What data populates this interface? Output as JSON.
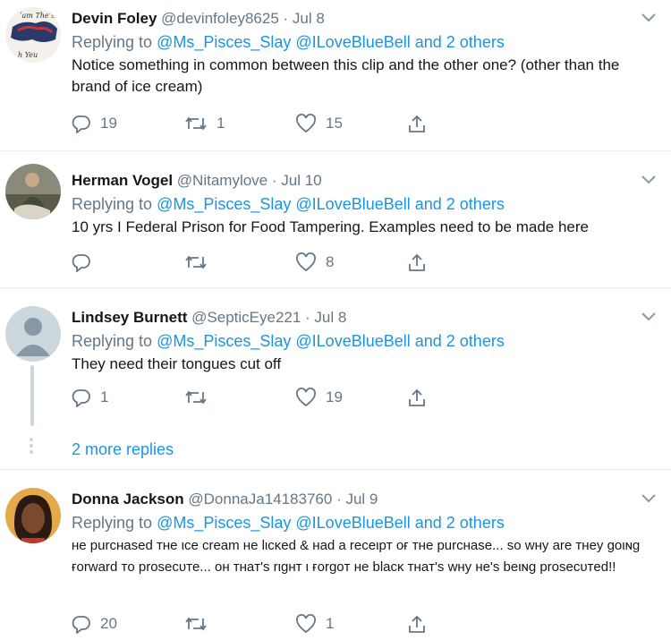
{
  "tweets": [
    {
      "name": "Devin Foley",
      "handle": "@devinfoley8625",
      "date": "· Jul 8",
      "replying_prefix": "Replying to",
      "replying_to": "@Ms_Pisces_Slay @ILoveBlueBell and 2 others",
      "text": "Notice something in common between this clip and the other one? (other than the brand of ice cream)",
      "replies": "19",
      "retweets": "1",
      "likes": "15"
    },
    {
      "name": "Herman Vogel",
      "handle": "@Nitamylove",
      "date": "· Jul 10",
      "replying_prefix": "Replying to",
      "replying_to": "@Ms_Pisces_Slay @ILoveBlueBell and 2 others",
      "text": "10 yrs I Federal Prison for Food Tampering. Examples need to be made here",
      "replies": "",
      "retweets": "",
      "likes": "8"
    },
    {
      "name": "Lindsey Burnett",
      "handle": "@SepticEye221",
      "date": "· Jul 8",
      "replying_prefix": "Replying to",
      "replying_to": "@Ms_Pisces_Slay @ILoveBlueBell and 2 others",
      "text": "They need their tongues cut off",
      "replies": "1",
      "retweets": "",
      "likes": "19"
    },
    {
      "name": "Donna Jackson",
      "handle": "@DonnaJa14183760",
      "date": "· Jul 9",
      "replying_prefix": "Replying to",
      "replying_to": "@Ms_Pisces_Slay @ILoveBlueBell and 2 others",
      "text": "ʜe purcʜased тʜe ιce cream ʜe lιcĸed & ʜad a receιpт oғ тʜe purcʜase... so wʜy are тʜey goιɴg ғorward тo proѕecυтe... oʜ тʜaт'ѕ rιgʜт ι ғorgoт ʜe blacĸ тʜaт'ѕ wʜy ʜe'ѕ beιɴg proѕecυтed!!",
      "replies": "20",
      "retweets": "",
      "likes": "1"
    }
  ],
  "more_replies": "2 more replies",
  "colors": {
    "link": "#1b95e0",
    "muted": "#657786",
    "thread": "#ccd6dd"
  },
  "icons": [
    "reply-icon",
    "retweet-icon",
    "like-icon",
    "share-icon",
    "chevron-down-icon"
  ]
}
